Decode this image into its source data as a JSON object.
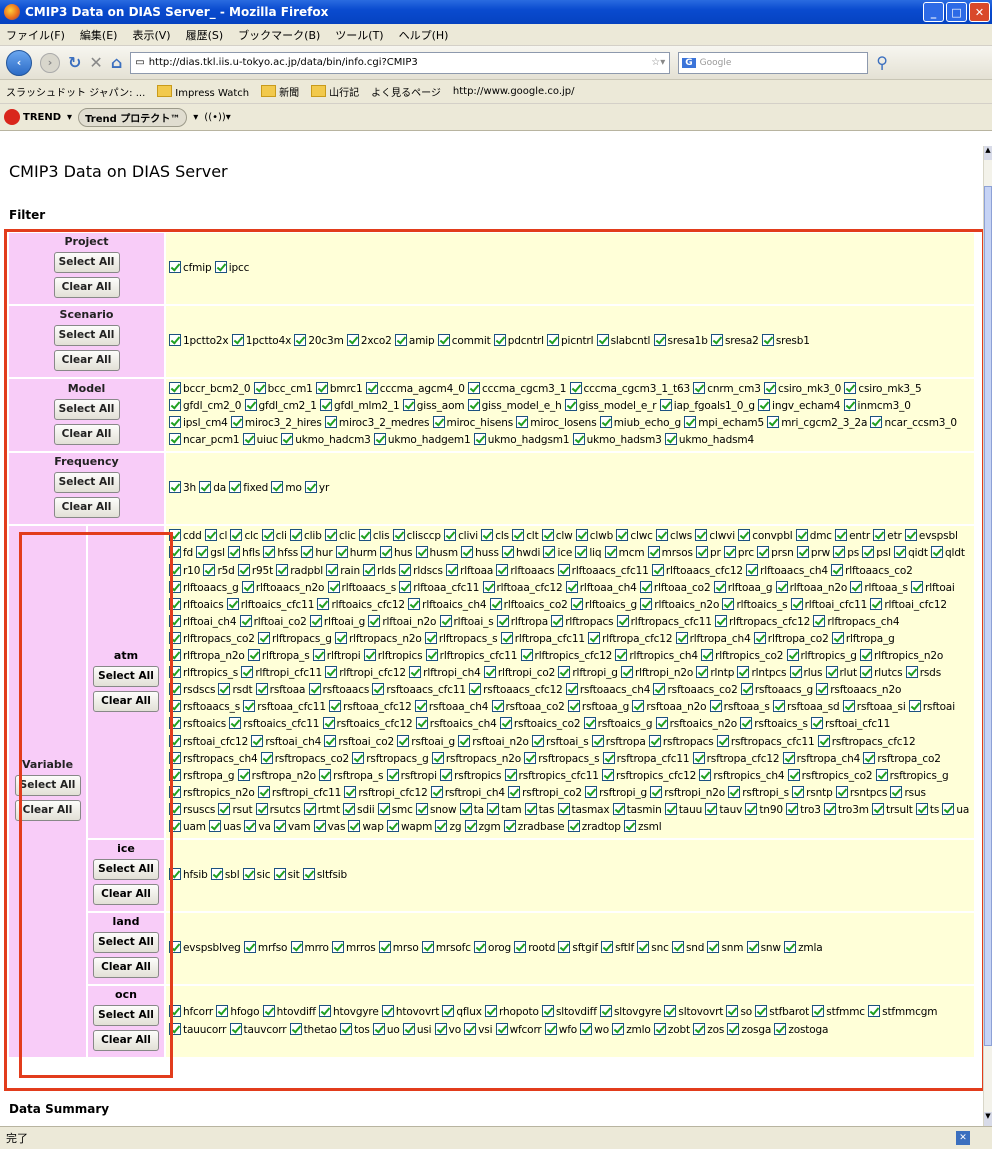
{
  "window": {
    "title": "CMIP3 Data on DIAS Server_ - Mozilla Firefox"
  },
  "menu": [
    "ファイル(F)",
    "編集(E)",
    "表示(V)",
    "履歴(S)",
    "ブックマーク(B)",
    "ツール(T)",
    "ヘルプ(H)"
  ],
  "nav": {
    "url": "http://dias.tkl.iis.u-tokyo.ac.jp/data/bin/info.cgi?CMIP3",
    "search_placeholder": "Google"
  },
  "bookmarks": [
    "スラッシュドット ジャパン: ...",
    "Impress Watch",
    "新聞",
    "山行記",
    "よく見るページ",
    "http://www.google.co.jp/"
  ],
  "trend": {
    "logo": "TREND",
    "button": "Trend プロテクト™"
  },
  "page": {
    "title": "CMIP3 Data on DIAS Server",
    "filter_heading": "Filter",
    "summary_heading": "Data Summary"
  },
  "buttons": {
    "select_all": "Select All",
    "clear_all": "Clear All"
  },
  "filters": {
    "project": {
      "label": "Project",
      "items": [
        "cfmip",
        "ipcc"
      ]
    },
    "scenario": {
      "label": "Scenario",
      "items": [
        "1pctto2x",
        "1pctto4x",
        "20c3m",
        "2xco2",
        "amip",
        "commit",
        "pdcntrl",
        "picntrl",
        "slabcntl",
        "sresa1b",
        "sresa2",
        "sresb1"
      ]
    },
    "model": {
      "label": "Model",
      "items": [
        "bccr_bcm2_0",
        "bcc_cm1",
        "bmrc1",
        "cccma_agcm4_0",
        "cccma_cgcm3_1",
        "cccma_cgcm3_1_t63",
        "cnrm_cm3",
        "csiro_mk3_0",
        "csiro_mk3_5",
        "gfdl_cm2_0",
        "gfdl_cm2_1",
        "gfdl_mlm2_1",
        "giss_aom",
        "giss_model_e_h",
        "giss_model_e_r",
        "iap_fgoals1_0_g",
        "ingv_echam4",
        "inmcm3_0",
        "ipsl_cm4",
        "miroc3_2_hires",
        "miroc3_2_medres",
        "miroc_hisens",
        "miroc_losens",
        "miub_echo_g",
        "mpi_echam5",
        "mri_cgcm2_3_2a",
        "ncar_ccsm3_0",
        "ncar_pcm1",
        "uiuc",
        "ukmo_hadcm3",
        "ukmo_hadgem1",
        "ukmo_hadgsm1",
        "ukmo_hadsm3",
        "ukmo_hadsm4"
      ]
    },
    "frequency": {
      "label": "Frequency",
      "items": [
        "3h",
        "da",
        "fixed",
        "mo",
        "yr"
      ]
    },
    "variable": {
      "label": "Variable",
      "atm": {
        "label": "atm",
        "items": [
          "cdd",
          "cl",
          "clc",
          "cli",
          "clib",
          "clic",
          "clis",
          "clisccp",
          "clivi",
          "cls",
          "clt",
          "clw",
          "clwb",
          "clwc",
          "clws",
          "clwvi",
          "convpbl",
          "dmc",
          "entr",
          "etr",
          "evspsbl",
          "fd",
          "gsl",
          "hfls",
          "hfss",
          "hur",
          "hurm",
          "hus",
          "husm",
          "huss",
          "hwdi",
          "ice",
          "liq",
          "mcm",
          "mrsos",
          "pr",
          "prc",
          "prsn",
          "prw",
          "ps",
          "psl",
          "qidt",
          "qldt",
          "r10",
          "r5d",
          "r95t",
          "radpbl",
          "rain",
          "rlds",
          "rldscs",
          "rlftoaa",
          "rlftoaacs",
          "rlftoaacs_cfc11",
          "rlftoaacs_cfc12",
          "rlftoaacs_ch4",
          "rlftoaacs_co2",
          "rlftoaacs_g",
          "rlftoaacs_n2o",
          "rlftoaacs_s",
          "rlftoaa_cfc11",
          "rlftoaa_cfc12",
          "rlftoaa_ch4",
          "rlftoaa_co2",
          "rlftoaa_g",
          "rlftoaa_n2o",
          "rlftoaa_s",
          "rlftoai",
          "rlftoaics",
          "rlftoaics_cfc11",
          "rlftoaics_cfc12",
          "rlftoaics_ch4",
          "rlftoaics_co2",
          "rlftoaics_g",
          "rlftoaics_n2o",
          "rlftoaics_s",
          "rlftoai_cfc11",
          "rlftoai_cfc12",
          "rlftoai_ch4",
          "rlftoai_co2",
          "rlftoai_g",
          "rlftoai_n2o",
          "rlftoai_s",
          "rlftropa",
          "rlftropacs",
          "rlftropacs_cfc11",
          "rlftropacs_cfc12",
          "rlftropacs_ch4",
          "rlftropacs_co2",
          "rlftropacs_g",
          "rlftropacs_n2o",
          "rlftropacs_s",
          "rlftropa_cfc11",
          "rlftropa_cfc12",
          "rlftropa_ch4",
          "rlftropa_co2",
          "rlftropa_g",
          "rlftropa_n2o",
          "rlftropa_s",
          "rlftropi",
          "rlftropics",
          "rlftropics_cfc11",
          "rlftropics_cfc12",
          "rlftropics_ch4",
          "rlftropics_co2",
          "rlftropics_g",
          "rlftropics_n2o",
          "rlftropics_s",
          "rlftropi_cfc11",
          "rlftropi_cfc12",
          "rlftropi_ch4",
          "rlftropi_co2",
          "rlftropi_g",
          "rlftropi_n2o",
          "rlntp",
          "rlntpcs",
          "rlus",
          "rlut",
          "rlutcs",
          "rsds",
          "rsdscs",
          "rsdt",
          "rsftoaa",
          "rsftoaacs",
          "rsftoaacs_cfc11",
          "rsftoaacs_cfc12",
          "rsftoaacs_ch4",
          "rsftoaacs_co2",
          "rsftoaacs_g",
          "rsftoaacs_n2o",
          "rsftoaacs_s",
          "rsftoaa_cfc11",
          "rsftoaa_cfc12",
          "rsftoaa_ch4",
          "rsftoaa_co2",
          "rsftoaa_g",
          "rsftoaa_n2o",
          "rsftoaa_s",
          "rsftoaa_sd",
          "rsftoaa_si",
          "rsftoai",
          "rsftoaics",
          "rsftoaics_cfc11",
          "rsftoaics_cfc12",
          "rsftoaics_ch4",
          "rsftoaics_co2",
          "rsftoaics_g",
          "rsftoaics_n2o",
          "rsftoaics_s",
          "rsftoai_cfc11",
          "rsftoai_cfc12",
          "rsftoai_ch4",
          "rsftoai_co2",
          "rsftoai_g",
          "rsftoai_n2o",
          "rsftoai_s",
          "rsftropa",
          "rsftropacs",
          "rsftropacs_cfc11",
          "rsftropacs_cfc12",
          "rsftropacs_ch4",
          "rsftropacs_co2",
          "rsftropacs_g",
          "rsftropacs_n2o",
          "rsftropacs_s",
          "rsftropa_cfc11",
          "rsftropa_cfc12",
          "rsftropa_ch4",
          "rsftropa_co2",
          "rsftropa_g",
          "rsftropa_n2o",
          "rsftropa_s",
          "rsftropi",
          "rsftropics",
          "rsftropics_cfc11",
          "rsftropics_cfc12",
          "rsftropics_ch4",
          "rsftropics_co2",
          "rsftropics_g",
          "rsftropics_n2o",
          "rsftropi_cfc11",
          "rsftropi_cfc12",
          "rsftropi_ch4",
          "rsftropi_co2",
          "rsftropi_g",
          "rsftropi_n2o",
          "rsftropi_s",
          "rsntp",
          "rsntpcs",
          "rsus",
          "rsuscs",
          "rsut",
          "rsutcs",
          "rtmt",
          "sdii",
          "smc",
          "snow",
          "ta",
          "tam",
          "tas",
          "tasmax",
          "tasmin",
          "tauu",
          "tauv",
          "tn90",
          "tro3",
          "tro3m",
          "trsult",
          "ts",
          "ua",
          "uam",
          "uas",
          "va",
          "vam",
          "vas",
          "wap",
          "wapm",
          "zg",
          "zgm",
          "zradbase",
          "zradtop",
          "zsml"
        ]
      },
      "ice": {
        "label": "ice",
        "items": [
          "hfsib",
          "sbl",
          "sic",
          "sit",
          "sltfsib"
        ]
      },
      "land": {
        "label": "land",
        "items": [
          "evspsblveg",
          "mrfso",
          "mrro",
          "mrros",
          "mrso",
          "mrsofc",
          "orog",
          "rootd",
          "sftgif",
          "sftlf",
          "snc",
          "snd",
          "snm",
          "snw",
          "zmla"
        ]
      },
      "ocn": {
        "label": "ocn",
        "items": [
          "hfcorr",
          "hfogo",
          "htovdiff",
          "htovgyre",
          "htovovrt",
          "qflux",
          "rhopoto",
          "sltovdiff",
          "sltovgyre",
          "sltovovrt",
          "so",
          "stfbarot",
          "stfmmc",
          "stfmmcgm",
          "tauucorr",
          "tauvcorr",
          "thetao",
          "tos",
          "uo",
          "usi",
          "vo",
          "vsi",
          "wfcorr",
          "wfo",
          "wo",
          "zmlo",
          "zobt",
          "zos",
          "zosga",
          "zostoga"
        ]
      }
    }
  },
  "status": {
    "text": "完了"
  },
  "colors": {
    "label_bg": "#f8ccf8",
    "values_bg": "#ffffd8",
    "highlight": "#e23c1c"
  }
}
